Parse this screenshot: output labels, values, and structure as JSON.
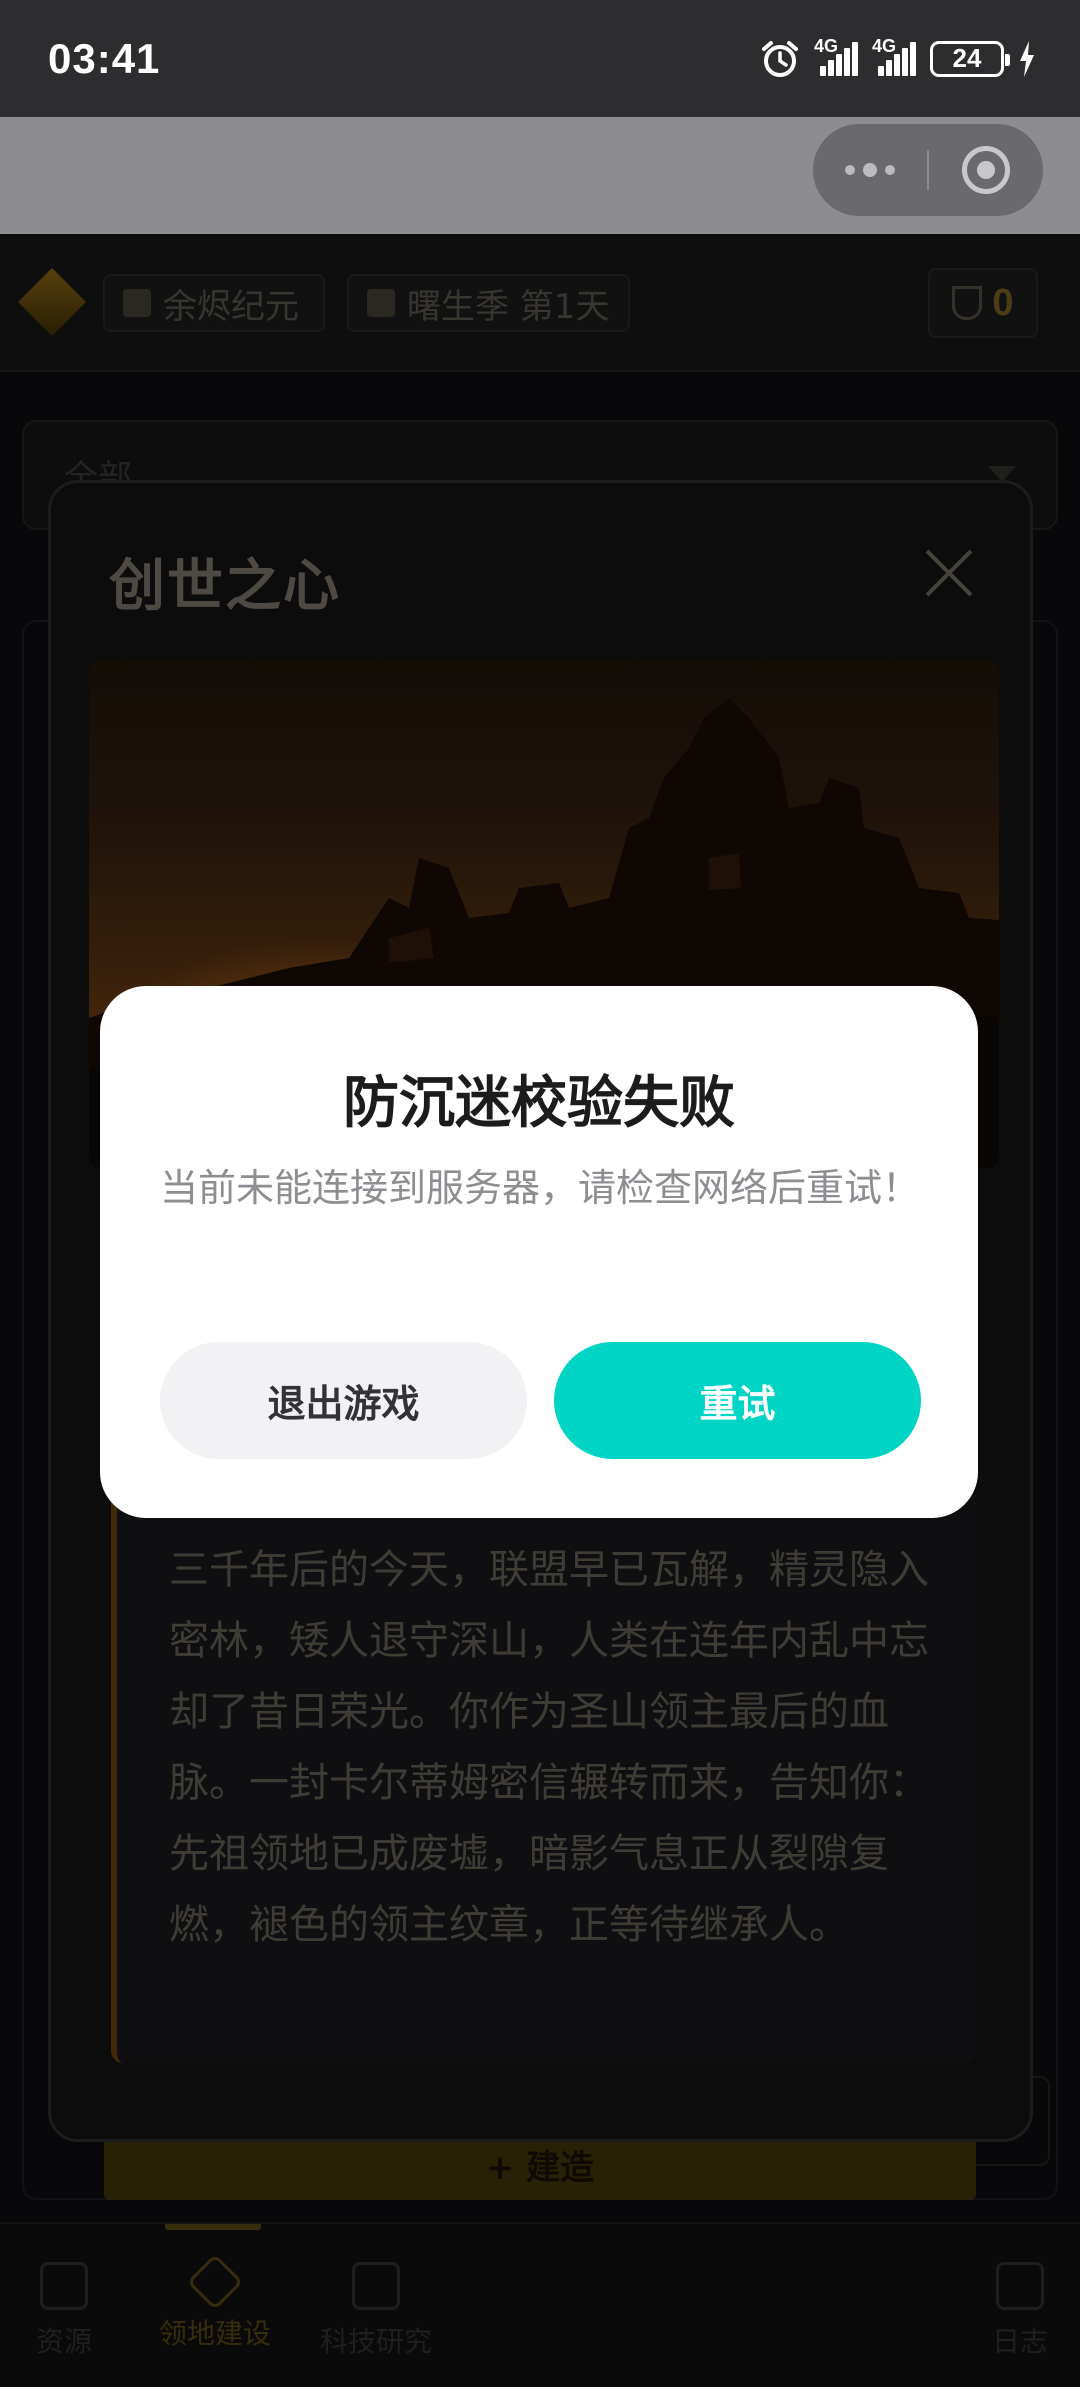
{
  "status_bar": {
    "time": "03:41",
    "network_1": "4G",
    "network_2": "4G",
    "battery": "24"
  },
  "header": {
    "era": "余烬纪元",
    "season": "曙生季 第1天",
    "trophy_count": "0"
  },
  "filter": {
    "selected": "全部"
  },
  "detail": {
    "title": "创世之心",
    "lore_paragraph": "三千年后的今天，联盟早已瓦解，精灵隐入密林，矮人退守深山，人类在连年内乱中忘却了昔日荣光。你作为圣山领主最后的血脉。一封卡尔蒂姆密信辗转而来，告知你：先祖领地已成废墟，暗影气息正从裂隙复燃，褪色的领主纹章，正等待继承人。"
  },
  "build_button": "+ 建造",
  "bottom_nav": [
    {
      "label": "资源",
      "active": false
    },
    {
      "label": "领地建设",
      "active": true
    },
    {
      "label": "科技研究",
      "active": false
    },
    {
      "label": "日志",
      "active": false
    }
  ],
  "dialog": {
    "title": "防沉迷校验失败",
    "message": "当前未能连接到服务器，请检查网络后重试！",
    "exit_label": "退出游戏",
    "retry_label": "重试",
    "retry_color": "#00d4c5"
  }
}
